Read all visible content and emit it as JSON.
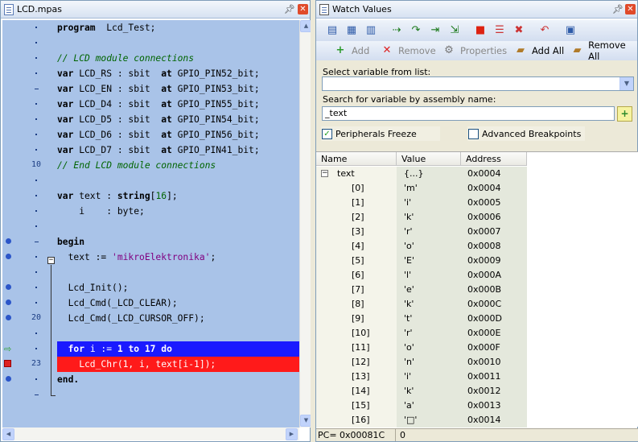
{
  "editor": {
    "title": "LCD.mpas",
    "gutter": [
      {
        "mark": "dot"
      },
      {
        "mark": "dot"
      },
      {
        "mark": "dot"
      },
      {
        "mark": "dot"
      },
      {
        "mark": "dash"
      },
      {
        "mark": "dot"
      },
      {
        "mark": "dot"
      },
      {
        "mark": "dot"
      },
      {
        "mark": "dot"
      },
      {
        "num": "10"
      },
      {
        "mark": "dot"
      },
      {
        "mark": "dot"
      },
      {
        "mark": "dot"
      },
      {
        "mark": "dot"
      },
      {
        "mark": "dash",
        "bp": true
      },
      {
        "mark": "dot",
        "bp": true
      },
      {
        "mark": "dot"
      },
      {
        "mark": "dot",
        "bp": true
      },
      {
        "mark": "dot",
        "bp": true
      },
      {
        "num": "20",
        "bp": true
      },
      {
        "mark": "dot"
      },
      {
        "mark": "dot",
        "arrow": true
      },
      {
        "num": "23",
        "check": true
      },
      {
        "mark": "dot",
        "bp": true
      },
      {
        "mark": "dash"
      }
    ],
    "lines": [
      {
        "parts": [
          {
            "t": "program",
            "c": "kw"
          },
          {
            "t": "  Lcd_Test;"
          }
        ]
      },
      {
        "parts": [
          {
            "t": ""
          }
        ]
      },
      {
        "parts": [
          {
            "t": "// LCD module connections",
            "c": "cm"
          }
        ]
      },
      {
        "parts": [
          {
            "t": "var",
            "c": "kw"
          },
          {
            "t": " LCD_RS : sbit  "
          },
          {
            "t": "at",
            "c": "kw"
          },
          {
            "t": " GPIO_PIN52_bit;"
          }
        ]
      },
      {
        "parts": [
          {
            "t": "var",
            "c": "kw"
          },
          {
            "t": " LCD_EN : sbit  "
          },
          {
            "t": "at",
            "c": "kw"
          },
          {
            "t": " GPIO_PIN53_bit;"
          }
        ]
      },
      {
        "parts": [
          {
            "t": "var",
            "c": "kw"
          },
          {
            "t": " LCD_D4 : sbit  "
          },
          {
            "t": "at",
            "c": "kw"
          },
          {
            "t": " GPIO_PIN55_bit;"
          }
        ]
      },
      {
        "parts": [
          {
            "t": "var",
            "c": "kw"
          },
          {
            "t": " LCD_D5 : sbit  "
          },
          {
            "t": "at",
            "c": "kw"
          },
          {
            "t": " GPIO_PIN54_bit;"
          }
        ]
      },
      {
        "parts": [
          {
            "t": "var",
            "c": "kw"
          },
          {
            "t": " LCD_D6 : sbit  "
          },
          {
            "t": "at",
            "c": "kw"
          },
          {
            "t": " GPIO_PIN56_bit;"
          }
        ]
      },
      {
        "parts": [
          {
            "t": "var",
            "c": "kw"
          },
          {
            "t": " LCD_D7 : sbit  "
          },
          {
            "t": "at",
            "c": "kw"
          },
          {
            "t": " GPIO_PIN41_bit;"
          }
        ]
      },
      {
        "parts": [
          {
            "t": "// End LCD module connections",
            "c": "cm"
          }
        ]
      },
      {
        "parts": [
          {
            "t": ""
          }
        ]
      },
      {
        "parts": [
          {
            "t": "var",
            "c": "kw"
          },
          {
            "t": " text : "
          },
          {
            "t": "string",
            "c": "kw"
          },
          {
            "t": "["
          },
          {
            "t": "16",
            "c": "nm"
          },
          {
            "t": "];"
          }
        ]
      },
      {
        "parts": [
          {
            "t": "    i    : byte;"
          }
        ]
      },
      {
        "parts": [
          {
            "t": ""
          }
        ]
      },
      {
        "parts": [
          {
            "t": "begin",
            "c": "kw"
          }
        ]
      },
      {
        "parts": [
          {
            "t": "  text := "
          },
          {
            "t": "'mikroElektronika'",
            "c": "str"
          },
          {
            "t": ";"
          }
        ]
      },
      {
        "parts": [
          {
            "t": ""
          }
        ]
      },
      {
        "parts": [
          {
            "t": "  Lcd_Init();"
          }
        ]
      },
      {
        "parts": [
          {
            "t": "  Lcd_Cmd(_LCD_CLEAR);"
          }
        ]
      },
      {
        "parts": [
          {
            "t": "  Lcd_Cmd(_LCD_CURSOR_OFF);"
          }
        ]
      },
      {
        "parts": [
          {
            "t": ""
          }
        ]
      },
      {
        "style": "sel",
        "parts": [
          {
            "t": "  "
          },
          {
            "t": "for",
            "c": "kw"
          },
          {
            "t": " i := "
          },
          {
            "t": "1",
            "c": "kw"
          },
          {
            "t": " "
          },
          {
            "t": "to",
            "c": "kw"
          },
          {
            "t": " "
          },
          {
            "t": "17",
            "c": "kw"
          },
          {
            "t": " "
          },
          {
            "t": "do",
            "c": "kw"
          }
        ]
      },
      {
        "style": "err",
        "parts": [
          {
            "t": "    Lcd_Chr(1, i, text[i-1]);"
          }
        ]
      },
      {
        "parts": [
          {
            "t": "end.",
            "c": "kw"
          }
        ]
      }
    ]
  },
  "watch": {
    "title": "Watch Values",
    "toolbar2": {
      "add": "Add",
      "remove": "Remove",
      "properties": "Properties",
      "add_all": "Add All",
      "remove_all": "Remove All"
    },
    "select_label": "Select variable from list:",
    "search_label": "Search for variable by assembly name:",
    "search_value": "_text",
    "peripherals_freeze": "Peripherals Freeze",
    "advanced_breakpoints": "Advanced Breakpoints",
    "columns": [
      "Name",
      "Value",
      "Address"
    ],
    "rows": [
      {
        "name": "text",
        "value": "{...}",
        "address": "0x0004",
        "parent": true
      },
      {
        "name": "[0]",
        "value": "'m'",
        "address": "0x0004"
      },
      {
        "name": "[1]",
        "value": "'i'",
        "address": "0x0005"
      },
      {
        "name": "[2]",
        "value": "'k'",
        "address": "0x0006"
      },
      {
        "name": "[3]",
        "value": "'r'",
        "address": "0x0007"
      },
      {
        "name": "[4]",
        "value": "'o'",
        "address": "0x0008"
      },
      {
        "name": "[5]",
        "value": "'E'",
        "address": "0x0009"
      },
      {
        "name": "[6]",
        "value": "'l'",
        "address": "0x000A"
      },
      {
        "name": "[7]",
        "value": "'e'",
        "address": "0x000B"
      },
      {
        "name": "[8]",
        "value": "'k'",
        "address": "0x000C"
      },
      {
        "name": "[9]",
        "value": "'t'",
        "address": "0x000D"
      },
      {
        "name": "[10]",
        "value": "'r'",
        "address": "0x000E"
      },
      {
        "name": "[11]",
        "value": "'o'",
        "address": "0x000F"
      },
      {
        "name": "[12]",
        "value": "'n'",
        "address": "0x0010"
      },
      {
        "name": "[13]",
        "value": "'i'",
        "address": "0x0011"
      },
      {
        "name": "[14]",
        "value": "'k'",
        "address": "0x0012"
      },
      {
        "name": "[15]",
        "value": "'a'",
        "address": "0x0013"
      },
      {
        "name": "[16]",
        "value": "'□'",
        "address": "0x0014"
      }
    ],
    "status_pc": "PC= 0x00081C",
    "status_val": "0"
  }
}
